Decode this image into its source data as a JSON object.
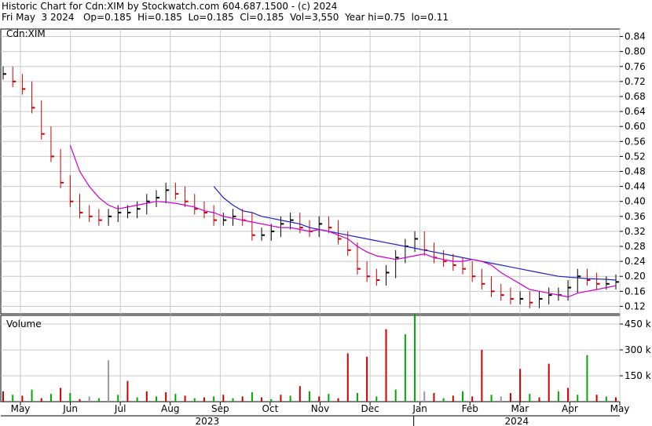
{
  "header": {
    "line1": "Historic Chart for Cdn:XIM by Stockwatch.com 604.687.1500 - (c) 2024",
    "line2": "Fri May  3 2024   Op=0.185  Hi=0.185  Lo=0.185  Cl=0.185  Vol=3,550  Year hi=0.75  lo=0.11"
  },
  "colors": {
    "up": "#000000",
    "down": "#cc0000",
    "ma_short": "#cc00cc",
    "ma_long": "#2020c0",
    "vol_up": "#00aa00",
    "vol_down": "#cc0000",
    "vol_neutral": "#999999",
    "grid": "#c8c8c8"
  },
  "chart_data": [
    {
      "type": "line",
      "label": "Cdn:XIM",
      "ylim": [
        0.1,
        0.86
      ],
      "y_ticks": [
        "0.84",
        "0.80",
        "0.76",
        "0.72",
        "0.68",
        "0.64",
        "0.60",
        "0.56",
        "0.52",
        "0.48",
        "0.44",
        "0.40",
        "0.36",
        "0.32",
        "0.28",
        "0.24",
        "0.20",
        "0.16",
        "0.12"
      ],
      "x_months": [
        "May",
        "Jun",
        "Jul",
        "Aug",
        "Sep",
        "Oct",
        "Nov",
        "Dec",
        "Jan",
        "Feb",
        "Mar",
        "Apr",
        "May"
      ],
      "x_years": [
        "2023",
        "2024"
      ],
      "grid": true,
      "price_weekly": [
        0.74,
        0.72,
        0.7,
        0.65,
        0.58,
        0.52,
        0.45,
        0.4,
        0.37,
        0.36,
        0.35,
        0.36,
        0.37,
        0.37,
        0.38,
        0.4,
        0.41,
        0.43,
        0.42,
        0.4,
        0.38,
        0.37,
        0.35,
        0.35,
        0.36,
        0.35,
        0.31,
        0.31,
        0.32,
        0.34,
        0.35,
        0.33,
        0.32,
        0.34,
        0.33,
        0.3,
        0.27,
        0.22,
        0.2,
        0.19,
        0.21,
        0.25,
        0.28,
        0.3,
        0.27,
        0.25,
        0.24,
        0.23,
        0.22,
        0.2,
        0.18,
        0.16,
        0.15,
        0.14,
        0.14,
        0.13,
        0.14,
        0.15,
        0.15,
        0.17,
        0.2,
        0.19,
        0.18,
        0.18,
        0.185
      ],
      "ma_short_weekly": [
        null,
        null,
        null,
        null,
        null,
        null,
        null,
        0.55,
        0.48,
        0.44,
        0.41,
        0.39,
        0.38,
        0.385,
        0.39,
        0.395,
        0.4,
        0.398,
        0.395,
        0.39,
        0.385,
        0.375,
        0.37,
        0.36,
        0.355,
        0.35,
        0.345,
        0.34,
        0.335,
        0.33,
        0.33,
        0.325,
        0.32,
        0.325,
        0.32,
        0.31,
        0.3,
        0.28,
        0.265,
        0.255,
        0.25,
        0.245,
        0.25,
        0.255,
        0.26,
        0.25,
        0.245,
        0.24,
        0.24,
        0.245,
        0.24,
        0.23,
        0.21,
        0.195,
        0.18,
        0.165,
        0.16,
        0.155,
        0.15,
        0.145,
        0.155,
        0.16,
        0.165,
        0.17,
        0.175
      ],
      "ma_long_weekly": [
        null,
        null,
        null,
        null,
        null,
        null,
        null,
        null,
        null,
        null,
        null,
        null,
        null,
        null,
        null,
        null,
        null,
        null,
        null,
        null,
        null,
        null,
        0.44,
        0.41,
        0.39,
        0.375,
        0.37,
        0.36,
        0.355,
        0.35,
        0.345,
        0.34,
        0.33,
        0.325,
        0.32,
        0.315,
        0.31,
        0.305,
        0.3,
        0.295,
        0.29,
        0.285,
        0.28,
        0.275,
        0.27,
        0.265,
        0.26,
        0.255,
        0.25,
        0.245,
        0.24,
        0.235,
        0.23,
        0.225,
        0.22,
        0.215,
        0.21,
        0.205,
        0.2,
        0.198,
        0.196,
        0.194,
        0.193,
        0.192,
        0.19
      ]
    },
    {
      "type": "bar",
      "label": "Volume",
      "y_ticks": [
        "450 k",
        "300 k",
        "150 k"
      ],
      "ylim": [
        0,
        500
      ],
      "volume_k_weekly": [
        60,
        40,
        35,
        70,
        20,
        45,
        80,
        50,
        15,
        30,
        20,
        240,
        40,
        120,
        25,
        60,
        30,
        55,
        45,
        35,
        20,
        25,
        30,
        40,
        20,
        30,
        55,
        25,
        15,
        40,
        35,
        90,
        60,
        30,
        45,
        20,
        280,
        50,
        260,
        30,
        420,
        70,
        390,
        510,
        60,
        50,
        20,
        35,
        60,
        30,
        300,
        40,
        30,
        50,
        190,
        45,
        25,
        220,
        60,
        80,
        40,
        270,
        40,
        30,
        25
      ],
      "volume_dir_weekly": [
        "d",
        "u",
        "d",
        "u",
        "d",
        "u",
        "d",
        "u",
        "d",
        "n",
        "u",
        "n",
        "u",
        "d",
        "u",
        "d",
        "u",
        "d",
        "u",
        "d",
        "u",
        "d",
        "u",
        "d",
        "u",
        "d",
        "u",
        "d",
        "u",
        "d",
        "u",
        "d",
        "u",
        "d",
        "u",
        "d",
        "d",
        "u",
        "d",
        "u",
        "d",
        "u",
        "u",
        "u",
        "n",
        "d",
        "u",
        "d",
        "u",
        "d",
        "d",
        "u",
        "n",
        "d",
        "d",
        "u",
        "d",
        "d",
        "u",
        "d",
        "u",
        "u",
        "d",
        "u",
        "d"
      ]
    }
  ]
}
